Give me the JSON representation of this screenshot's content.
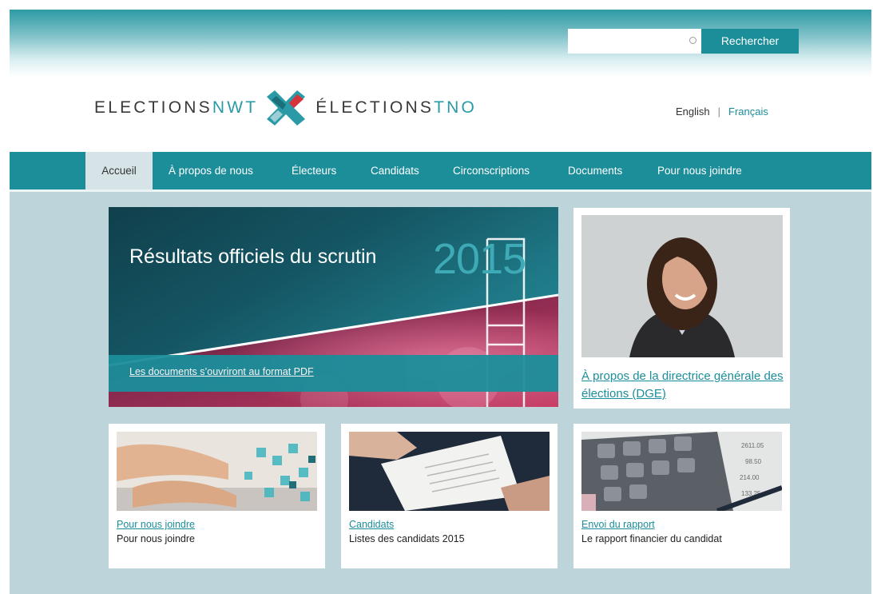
{
  "header": {
    "search": {
      "value": "",
      "placeholder": "",
      "button_label": "Rechercher"
    },
    "logo": {
      "en_part1": "ELECTIONS",
      "en_part2": "NWT",
      "fr_part1": "ÉLECTIONS",
      "fr_part2": "TNO"
    },
    "languages": {
      "english": "English",
      "separator": "|",
      "french": "Français"
    }
  },
  "nav": {
    "items": [
      {
        "label": "Accueil",
        "active": true
      },
      {
        "label": "À propos de nous"
      },
      {
        "label": "Électeurs"
      },
      {
        "label": "Candidats"
      },
      {
        "label": "Circonscriptions"
      },
      {
        "label": "Documents"
      },
      {
        "label": "Pour nous joindre"
      }
    ]
  },
  "hero": {
    "title": "Résultats officiels du scrutin",
    "year": "2015",
    "caption": "Les documents s’ouvriront au format PDF"
  },
  "featured": {
    "link": "À propos de la directrice générale des élections (DGE)"
  },
  "cards": [
    {
      "link": "Pour nous joindre",
      "desc": "Pour nous joindre"
    },
    {
      "link": "Candidats",
      "desc": "Listes des candidats 2015"
    },
    {
      "link": "Envoi du rapport",
      "desc": "Le rapport financier du candidat"
    }
  ],
  "colors": {
    "teal": "#1b8e9a",
    "background": "#bcd4da",
    "logo_red": "#d7333c"
  }
}
